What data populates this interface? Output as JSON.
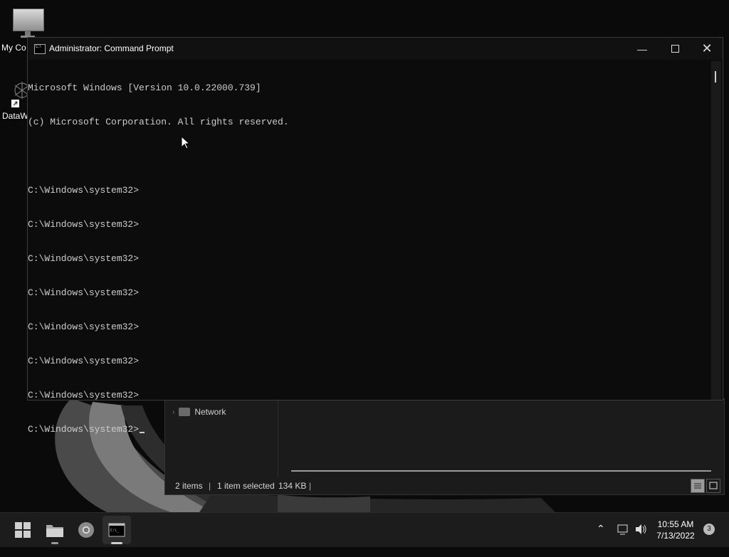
{
  "desktop": {
    "icons": [
      {
        "label": "My Co"
      },
      {
        "label": "DataW"
      }
    ]
  },
  "cmd": {
    "title": "Administrator: Command Prompt",
    "lines": [
      "Microsoft Windows [Version 10.0.22000.739]",
      "(c) Microsoft Corporation. All rights reserved.",
      "",
      "C:\\Windows\\system32>",
      "C:\\Windows\\system32>",
      "C:\\Windows\\system32>",
      "C:\\Windows\\system32>",
      "C:\\Windows\\system32>",
      "C:\\Windows\\system32>",
      "C:\\Windows\\system32>",
      "C:\\Windows\\system32>",
      "C:\\Windows\\system32>"
    ]
  },
  "explorer": {
    "nav_network": "Network",
    "status": {
      "items": "2 items",
      "selected": "1 item selected",
      "size": "134 KB"
    }
  },
  "taskbar": {
    "time": "10:55 AM",
    "date": "7/13/2022",
    "notifications": "3",
    "icons": [
      "windows-start-icon",
      "file-explorer-icon",
      "chrome-icon",
      "command-prompt-icon"
    ]
  }
}
